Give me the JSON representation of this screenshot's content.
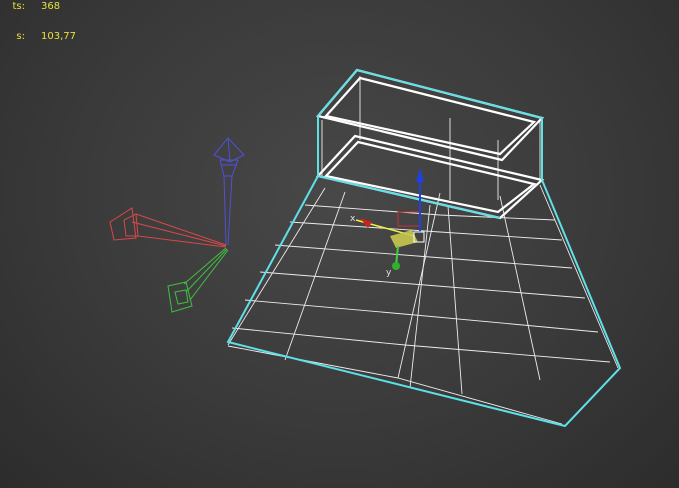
{
  "viewport_stats": {
    "points": {
      "label": "ts:",
      "value": "368"
    },
    "fps": {
      "label": "s:",
      "value": "103,77"
    }
  },
  "gizmo": {
    "axis_x_label": "x",
    "axis_y_label": "y"
  },
  "colors": {
    "background": "#3a3a3a",
    "stats_text": "#e8e040",
    "selection_outline": "#5ee0e8",
    "wireframe": "#ffffff",
    "axis_x": "#e04040",
    "axis_y": "#40d040",
    "axis_z": "#4040e0"
  }
}
